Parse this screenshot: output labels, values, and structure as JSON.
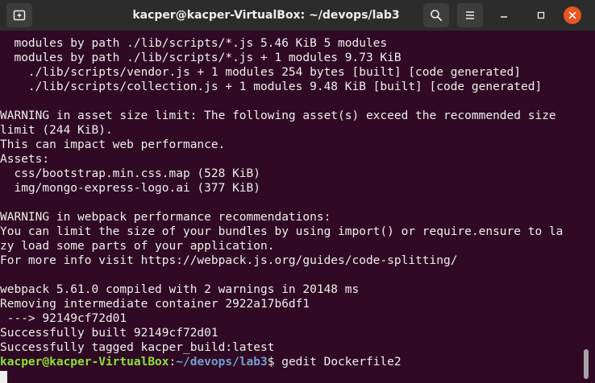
{
  "window": {
    "title": "kacper@kacper-VirtualBox: ~/devops/lab3"
  },
  "icons": {
    "new_tab": "new-tab-icon",
    "search": "search-icon",
    "menu": "hamburger-menu-icon",
    "minimize": "minimize-icon",
    "maximize": "maximize-icon",
    "close": "close-icon"
  },
  "colors": {
    "terminal_bg": "#300a24",
    "titlebar_bg": "#2c2c2c",
    "text": "#eeeeec",
    "prompt_user": "#8ae234",
    "prompt_path": "#729fcf",
    "close_button": "#e95420"
  },
  "terminal": {
    "lines": [
      "  modules by path ./lib/scripts/*.js 5.46 KiB 5 modules",
      "  modules by path ./lib/scripts/*.js + 1 modules 9.73 KiB",
      "    ./lib/scripts/vendor.js + 1 modules 254 bytes [built] [code generated]",
      "    ./lib/scripts/collection.js + 1 modules 9.48 KiB [built] [code generated]",
      "",
      "WARNING in asset size limit: The following asset(s) exceed the recommended size",
      "limit (244 KiB).",
      "This can impact web performance.",
      "Assets:",
      "  css/bootstrap.min.css.map (528 KiB)",
      "  img/mongo-express-logo.ai (377 KiB)",
      "",
      "WARNING in webpack performance recommendations:",
      "You can limit the size of your bundles by using import() or require.ensure to la",
      "zy load some parts of your application.",
      "For more info visit https://webpack.js.org/guides/code-splitting/",
      "",
      "webpack 5.61.0 compiled with 2 warnings in 20148 ms",
      "Removing intermediate container 2922a17b6df1",
      " ---> 92149cf72d01",
      "Successfully built 92149cf72d01",
      "Successfully tagged kacper_build:latest"
    ],
    "prompt": {
      "user_host": "kacper@kacper-VirtualBox",
      "colon": ":",
      "path": "~/devops/lab3",
      "symbol": "$ ",
      "command": "gedit Dockerfile2"
    }
  }
}
